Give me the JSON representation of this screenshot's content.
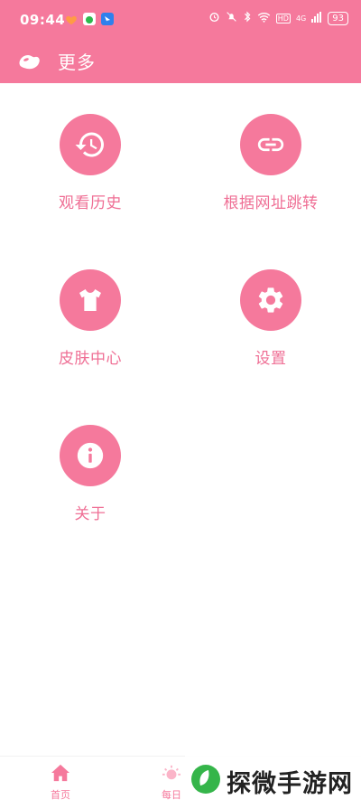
{
  "status_bar": {
    "time": "09:44",
    "network": "4G",
    "hd_label": "HD",
    "battery": "93"
  },
  "app_bar": {
    "title": "更多"
  },
  "menu": {
    "items": [
      {
        "label": "观看历史",
        "icon": "history-icon"
      },
      {
        "label": "根据网址跳转",
        "icon": "link-icon"
      },
      {
        "label": "皮肤中心",
        "icon": "tshirt-icon"
      },
      {
        "label": "设置",
        "icon": "gear-icon"
      },
      {
        "label": "关于",
        "icon": "info-icon"
      }
    ]
  },
  "bottom_nav": {
    "items": [
      {
        "label": "首页",
        "icon": "home-icon"
      },
      {
        "label": "每日",
        "icon": "sun-icon"
      }
    ]
  },
  "watermark": {
    "text": "探微手游网"
  },
  "colors": {
    "accent": "#f5799c",
    "label": "#ef6f95",
    "background": "#ffffff"
  }
}
